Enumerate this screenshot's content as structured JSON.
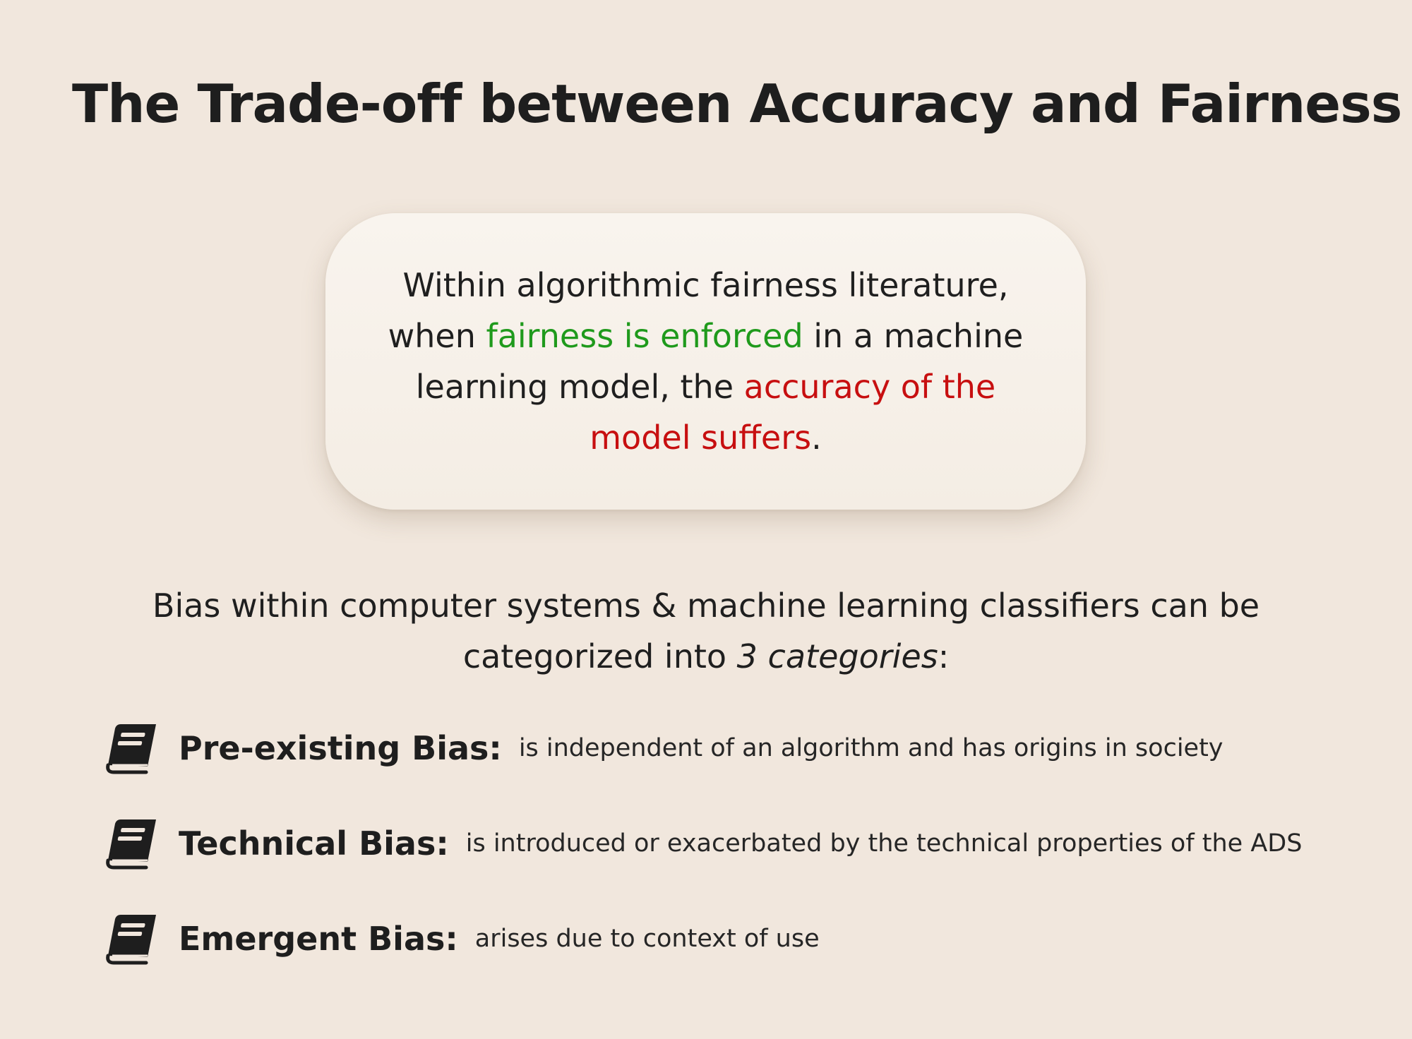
{
  "title": "The Trade-off between Accuracy and Fairness",
  "quote": {
    "part1": "Within algorithmic fairness literature, when ",
    "highlight_green": "fairness is enforced",
    "part2": " in a machine learning model, the ",
    "highlight_red": "accuracy of the model suffers",
    "part3": "."
  },
  "intro": {
    "text_before": "Bias within computer systems & machine learning classifiers can be categorized into ",
    "emphasis": "3 categories",
    "text_after": ":"
  },
  "biases": [
    {
      "name": "Pre-existing Bias:",
      "description": "is independent of an algorithm and has origins in society",
      "icon": "book-icon"
    },
    {
      "name": "Technical Bias:",
      "description": "is introduced or exacerbated by the technical properties of the ADS",
      "icon": "book-icon"
    },
    {
      "name": "Emergent Bias:",
      "description": "arises due to context of use",
      "icon": "book-icon"
    }
  ],
  "colors": {
    "background": "#f1e7dd",
    "green": "#1f9a1c",
    "red": "#c70f10",
    "text": "#1f1f1f"
  }
}
